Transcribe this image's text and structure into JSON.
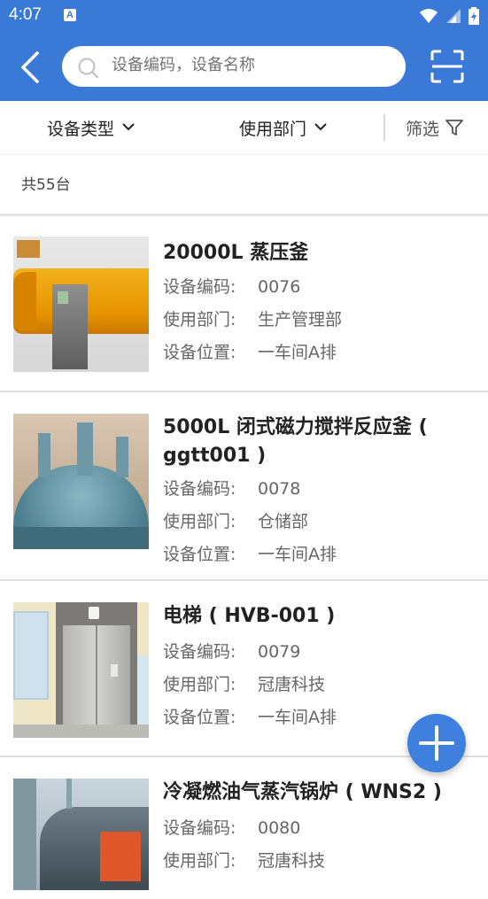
{
  "status_bar": {
    "time": "4:07",
    "notification_icon": "a-icon"
  },
  "header": {
    "search": {
      "placeholder": "设备编码，设备名称"
    },
    "back_icon": "back-chevron",
    "scan_icon": "scan-icon"
  },
  "filters": {
    "type_label": "设备类型",
    "dept_label": "使用部门",
    "screen_label": "筛选"
  },
  "summary": {
    "count_text": "共55台"
  },
  "labels": {
    "code": "设备编码:",
    "dept": "使用部门:",
    "location": "设备位置:"
  },
  "items": [
    {
      "title": "20000L 蒸压釜",
      "code": "0076",
      "dept": "生产管理部",
      "location": "一车间A排"
    },
    {
      "title": "5000L 闭式磁力搅拌反应釜 ( ggtt001 )",
      "code": "0078",
      "dept": "仓储部",
      "location": "一车间A排"
    },
    {
      "title": "电梯 ( HVB-001 )",
      "code": "0079",
      "dept": "冠唐科技",
      "location": "一车间A排"
    },
    {
      "title": "冷凝燃油气蒸汽锅炉 ( WNS2 )",
      "code": "0080",
      "dept": "冠唐科技",
      "location": ""
    }
  ],
  "colors": {
    "primary": "#3a7ad6",
    "fab": "#3f7fdd"
  }
}
